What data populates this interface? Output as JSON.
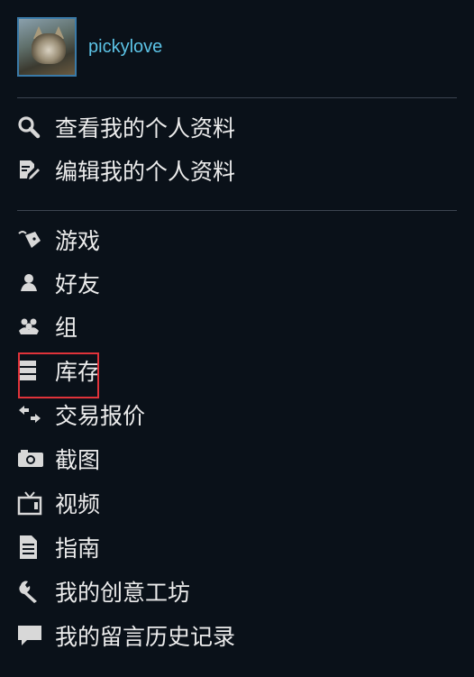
{
  "profile": {
    "username": "pickylove",
    "avatar": "fox-avatar"
  },
  "menu": {
    "profile_items": [
      {
        "label": "查看我的个人资料",
        "icon": "magnifier-icon"
      },
      {
        "label": "编辑我的个人资料",
        "icon": "edit-icon"
      }
    ],
    "main_items": [
      {
        "label": "游戏",
        "icon": "game-controller-icon"
      },
      {
        "label": "好友",
        "icon": "person-icon"
      },
      {
        "label": "组",
        "icon": "group-icon"
      },
      {
        "label": "库存",
        "icon": "inventory-icon"
      },
      {
        "label": "交易报价",
        "icon": "trade-arrows-icon"
      },
      {
        "label": "截图",
        "icon": "camera-icon"
      },
      {
        "label": "视频",
        "icon": "tv-icon"
      },
      {
        "label": "指南",
        "icon": "document-icon"
      },
      {
        "label": "我的创意工坊",
        "icon": "wrench-icon"
      },
      {
        "label": "我的留言历史记录",
        "icon": "speech-bubble-icon"
      }
    ]
  },
  "colors": {
    "background": "#0a1119",
    "username": "#5cc3e6",
    "avatar_border": "#3a7aa8",
    "divider": "#3c4450",
    "highlight_box": "#e0333a"
  }
}
